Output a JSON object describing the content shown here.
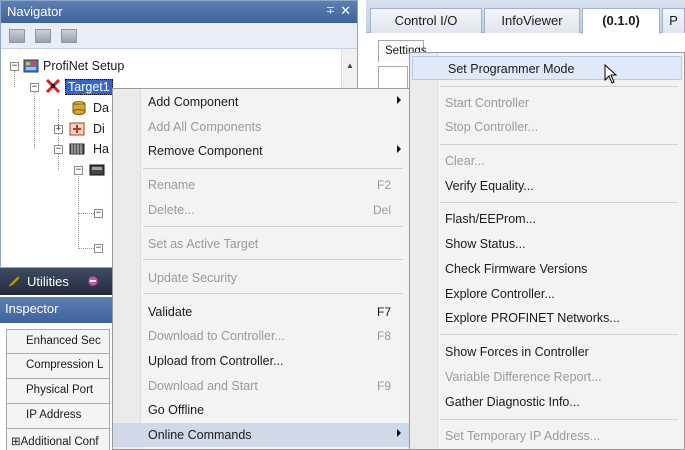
{
  "navigator": {
    "title": "Navigator",
    "pin_glyph": "∓",
    "close_glyph": "✕",
    "tree": {
      "root": "ProfiNet Setup",
      "target": "Target1",
      "da": "Da",
      "di": "Di",
      "ha": "Ha"
    }
  },
  "utilities": {
    "label": "Utilities"
  },
  "inspector": {
    "title": "Inspector",
    "rows": [
      "Enhanced Sec",
      "Compression L",
      "Physical Port",
      "IP Address",
      "⊞Additional Conf"
    ]
  },
  "tabs": {
    "items": [
      "Control I/O",
      "InfoViewer",
      "(0.1.0)",
      "P"
    ],
    "active": "(0.1.0)",
    "settings_label": "Settings"
  },
  "context_menu": {
    "items": [
      {
        "label": "Add Component",
        "submenu": true
      },
      {
        "label": "Add All Components",
        "disabled": true
      },
      {
        "label": "Remove Component",
        "submenu": true
      },
      {
        "label": "Rename",
        "shortcut": "F2",
        "disabled": true
      },
      {
        "label": "Delete...",
        "shortcut": "Del",
        "disabled": true
      },
      {
        "label": "Set as Active Target",
        "disabled": true
      },
      {
        "label": "Update Security",
        "disabled": true
      },
      {
        "label": "Validate",
        "shortcut": "F7"
      },
      {
        "label": "Download to Controller...",
        "shortcut": "F8",
        "disabled": true
      },
      {
        "label": "Upload from Controller..."
      },
      {
        "label": "Download and Start",
        "shortcut": "F9",
        "disabled": true
      },
      {
        "label": "Go Offline"
      },
      {
        "label": "Online Commands",
        "submenu": true,
        "highlighted": true
      }
    ]
  },
  "submenu": {
    "items": [
      {
        "label": "Set Programmer Mode",
        "highlighted": true
      },
      {
        "label": "Start Controller",
        "disabled": true
      },
      {
        "label": "Stop Controller...",
        "disabled": true
      },
      {
        "label": "Clear...",
        "disabled": true
      },
      {
        "label": "Verify Equality..."
      },
      {
        "label": "Flash/EEProm..."
      },
      {
        "label": "Show Status..."
      },
      {
        "label": "Check Firmware Versions"
      },
      {
        "label": "Explore Controller..."
      },
      {
        "label": "Explore PROFINET Networks..."
      },
      {
        "label": "Show Forces in Controller"
      },
      {
        "label": "Variable Difference Report...",
        "disabled": true
      },
      {
        "label": "Gather Diagnostic Info..."
      },
      {
        "label": "Set Temporary IP Address...",
        "disabled": true
      }
    ]
  },
  "colors": {
    "title_bar": "#4a6da6",
    "menu_bg": "#f3f3f3",
    "menu_highlight": "#d0d9e8",
    "disabled_text": "#9a9a9a"
  }
}
